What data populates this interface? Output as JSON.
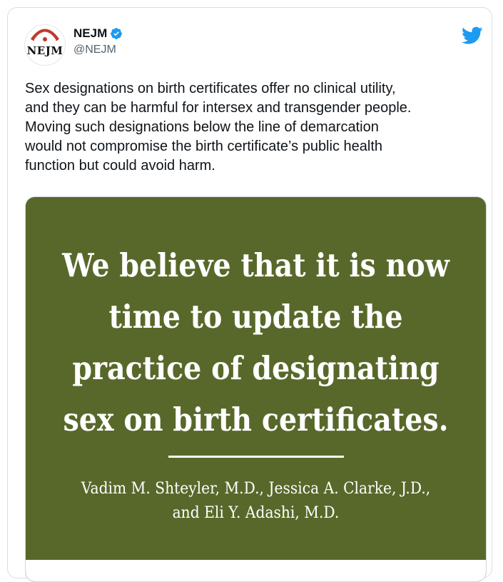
{
  "tweet": {
    "display_name": "NEJM",
    "handle": "@NEJM",
    "avatar_text": "NEJM",
    "verified": true,
    "text": "Sex designations on birth certificates offer no clinical utility,\nand they can be harmful for intersex and transgender people.\nMoving such designations below the line of demarcation\nwould not compromise the birth certificate’s public health\nfunction but could avoid harm."
  },
  "media": {
    "headline": "We believe that it is now\ntime to update the\npractice of designating\nsex on birth certificates.",
    "authors": "Vadim M. Shteyler, M.D., Jessica A. Clarke, J.D.,\nand Eli Y. Adashi, M.D."
  },
  "colors": {
    "media_background": "#58682a",
    "twitter_blue": "#1d9bf0",
    "handle_gray": "#536471",
    "seal_red": "#c0392b"
  },
  "icons": {
    "brand": "twitter-bird-icon",
    "verified": "verified-badge-icon"
  }
}
